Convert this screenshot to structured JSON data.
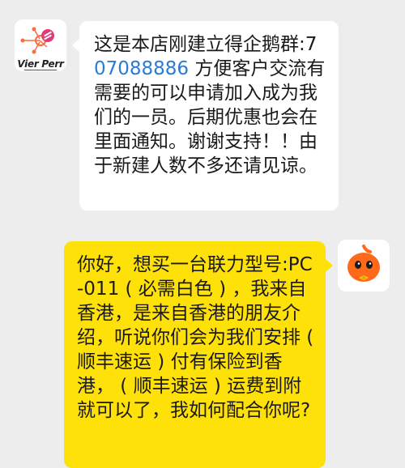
{
  "chat": {
    "incoming": {
      "sender_logo_text": "Vier Perr",
      "text_before": "这是本店刚建立得企鹅群:7",
      "phone": "07088886",
      "text_after": " 方便客户交流有需要的可以申请加入成为我们的一员。后期优惠也会在里面通知。谢谢支持！！由于新建人数不多还请见谅。"
    },
    "outgoing": {
      "text": "你好，想买一台联力型号:PC-011 ( 必需白色 ) ，我来自香港，是来自香港的朋友介绍，听说你们会为我们安排 ( 顺丰速运 ) 付有保险到香港， ( 顺丰速运 ) 运费到附就可以了，我如何配合你呢?"
    }
  },
  "colors": {
    "background": "#ededed",
    "incoming_bubble": "#ffffff",
    "outgoing_bubble": "#ffe10a",
    "link": "#2a7bd6",
    "avatar_orange": "#ff6a1a"
  },
  "icons": {
    "left_avatar": "network-logo-icon",
    "right_avatar": "orange-mascot-icon"
  }
}
